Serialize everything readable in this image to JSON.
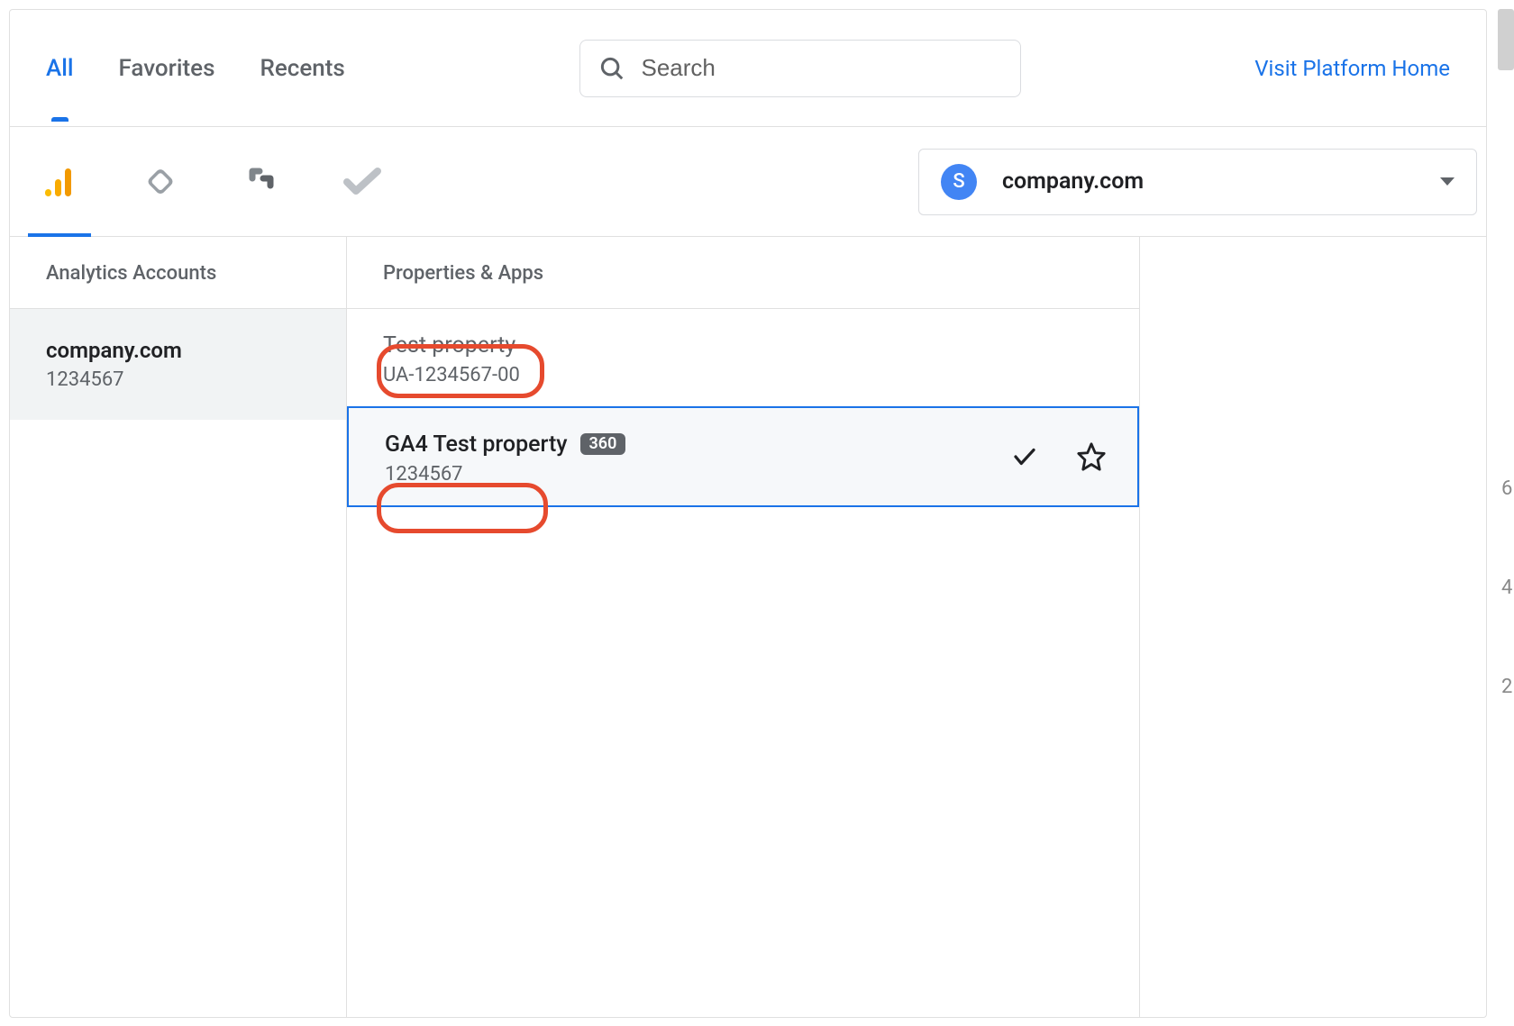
{
  "tabs": {
    "all": "All",
    "favorites": "Favorites",
    "recents": "Recents"
  },
  "search": {
    "placeholder": "Search"
  },
  "visit_link": "Visit Platform Home",
  "account_dropdown": {
    "avatar_letter": "S",
    "name": "company.com"
  },
  "columns": {
    "accounts_header": "Analytics Accounts",
    "properties_header": "Properties & Apps"
  },
  "accounts": [
    {
      "name": "company.com",
      "id": "1234567"
    }
  ],
  "properties": [
    {
      "name": "Test property",
      "id": "UA-1234567-00",
      "badge": "",
      "selected": false
    },
    {
      "name": "GA4 Test property",
      "id": "1234567",
      "badge": "360",
      "selected": true
    }
  ],
  "edge_marks": [
    "6",
    "4",
    "2"
  ]
}
